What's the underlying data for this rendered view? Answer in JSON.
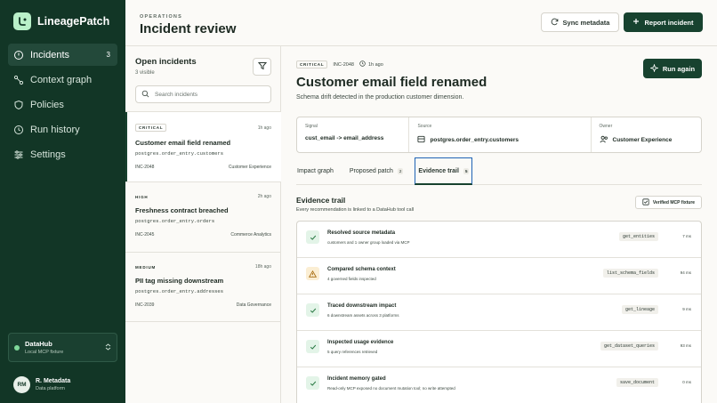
{
  "app": {
    "name": "LineagePatch"
  },
  "sidebar": {
    "items": [
      {
        "label": "Incidents",
        "count": "3",
        "icon": "alert-circle-icon"
      },
      {
        "label": "Context graph",
        "icon": "graph-icon"
      },
      {
        "label": "Policies",
        "icon": "shield-icon"
      },
      {
        "label": "Run history",
        "icon": "clock-icon"
      },
      {
        "label": "Settings",
        "icon": "sliders-icon"
      }
    ],
    "workspace": {
      "name": "DataHub",
      "sub": "Local MCP fixture"
    },
    "user": {
      "initials": "RM",
      "name": "R. Metadata",
      "role": "Data platform"
    }
  },
  "header": {
    "eyebrow": "OPERATIONS",
    "title": "Incident review",
    "sync_label": "Sync metadata",
    "report_label": "Report incident"
  },
  "list": {
    "title": "Open incidents",
    "subtitle": "3 visible",
    "search_placeholder": "Search incidents",
    "incidents": [
      {
        "severity": "CRITICAL",
        "time": "1h ago",
        "title": "Customer email field renamed",
        "path": "postgres.order_entry.customers",
        "id": "INC-2048",
        "owner": "Customer Experience"
      },
      {
        "severity": "HIGH",
        "time": "2h ago",
        "title": "Freshness contract breached",
        "path": "postgres.order_entry.orders",
        "id": "INC-2045",
        "owner": "Commerce Analytics"
      },
      {
        "severity": "MEDIUM",
        "time": "18h ago",
        "title": "PII tag missing downstream",
        "path": "postgres.order_entry.addresses",
        "id": "INC-2039",
        "owner": "Data Governance"
      }
    ]
  },
  "detail": {
    "severity": "CRITICAL",
    "id": "INC-2048",
    "time": "1h ago",
    "title": "Customer email field renamed",
    "description": "Schema drift detected in the production customer dimension.",
    "run_label": "Run again",
    "signal_label": "Signal",
    "signal_value": "cust_email -> email_address",
    "source_label": "Source",
    "source_value": "postgres.order_entry.customers",
    "owner_label": "Owner",
    "owner_value": "Customer Experience",
    "tabs": [
      {
        "label": "Impact graph",
        "count": ""
      },
      {
        "label": "Proposed patch",
        "count": "2"
      },
      {
        "label": "Evidence trail",
        "count": "5"
      }
    ],
    "evidence": {
      "title": "Evidence trail",
      "subtitle": "Every recommendation is linked to a DataHub tool call",
      "badge": "Verified MCP fixture",
      "steps": [
        {
          "name": "Resolved source metadata",
          "desc": "customers and 1 owner group loaded via MCP",
          "tool": "get_entities",
          "ms": "7 ms",
          "status": "ok"
        },
        {
          "name": "Compared schema context",
          "desc": "4 governed fields inspected",
          "tool": "list_schema_fields",
          "ms": "94 ms",
          "status": "warn"
        },
        {
          "name": "Traced downstream impact",
          "desc": "6 downstream assets across 3 platforms",
          "tool": "get_lineage",
          "ms": "9 ms",
          "status": "ok"
        },
        {
          "name": "Inspected usage evidence",
          "desc": "5 query references retrieved",
          "tool": "get_dataset_queries",
          "ms": "93 ms",
          "status": "ok"
        },
        {
          "name": "Incident memory gated",
          "desc": "Read-only MCP exposed no document mutation tool; no write attempted",
          "tool": "save_document",
          "ms": "0 ms",
          "status": "ok"
        }
      ]
    }
  },
  "colors": {
    "brand": "#123626",
    "accent": "#17422f",
    "ok": "#e3f4e8",
    "warn": "#fbeed3"
  }
}
